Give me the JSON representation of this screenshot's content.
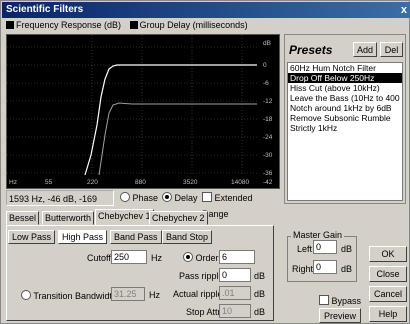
{
  "window": {
    "title": "Scientific Filters",
    "close_glyph": "x"
  },
  "legend": {
    "freq_label": "Frequency Response (dB)",
    "group_label": "Group Delay (milliseconds)"
  },
  "graph": {
    "db_ticks": [
      "dB",
      "0",
      "-6",
      "-12",
      "-18",
      "-24",
      "-30",
      "-36",
      "-42"
    ],
    "freq_ticks": [
      "Hz",
      "55",
      "220",
      "880",
      "3520",
      "14080"
    ]
  },
  "readout": {
    "value": "1593 Hz, -46 dB, -169",
    "phase_label": "Phase",
    "delay_label": "Delay",
    "extended_label": "Extended Range"
  },
  "presets": {
    "title": "Presets",
    "add_label": "Add",
    "del_label": "Del",
    "items": [
      "60Hz Hum Notch Filter",
      "Drop Off Below 250Hz",
      "Hiss Cut (above 10kHz)",
      "Leave the Bass (10Hz to 400 Hz)",
      "Notch around 1kHz by 6dB",
      "Remove Subsonic Rumble",
      "Strictly 1kHz"
    ]
  },
  "tabs": [
    "Bessel",
    "Butterworth",
    "Chebychev 1",
    "Chebychev 2"
  ],
  "subtabs": [
    "Low Pass",
    "High Pass",
    "Band Pass",
    "Band Stop"
  ],
  "filter": {
    "cutoff_label": "Cutoff",
    "cutoff_value": "250",
    "cutoff_unit": "Hz",
    "order_label": "Order",
    "order_value": "6",
    "pass_ripple_label": "Pass ripple",
    "pass_ripple_value": "0",
    "pass_ripple_unit": "dB",
    "transition_label": "Transition Bandwidth",
    "transition_value": "31.25",
    "transition_unit": "Hz",
    "actual_ripple_label": "Actual ripple",
    "actual_ripple_value": ".01",
    "actual_ripple_unit": "dB",
    "stop_attn_label": "Stop Attn",
    "stop_attn_value": "10",
    "stop_attn_unit": "dB"
  },
  "gain": {
    "title": "Master Gain",
    "left_label": "Left",
    "left_value": "0",
    "left_unit": "dB",
    "right_label": "Right",
    "right_value": "0",
    "right_unit": "dB"
  },
  "buttons": {
    "ok": "OK",
    "close": "Close",
    "cancel": "Cancel",
    "preview": "Preview",
    "help": "Help",
    "bypass": "Bypass"
  }
}
